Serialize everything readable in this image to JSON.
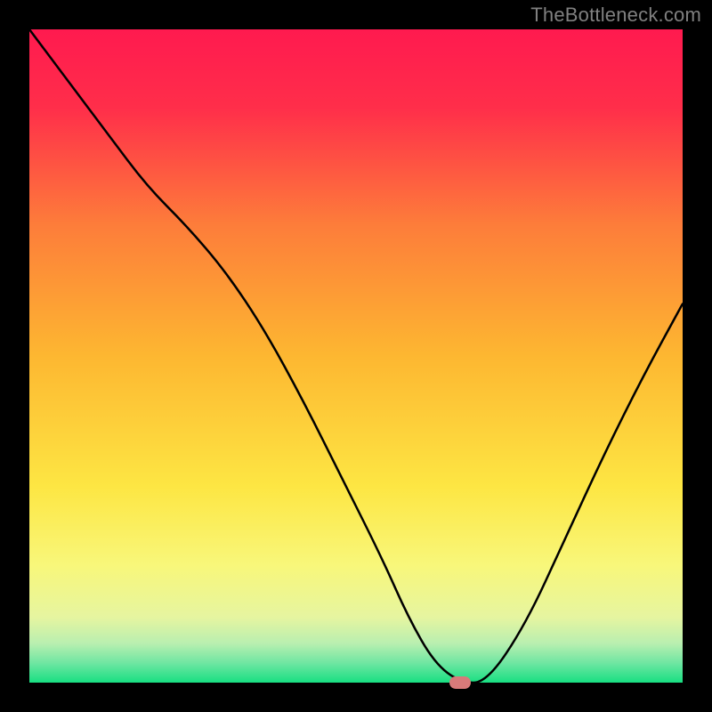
{
  "watermark": "TheBottleneck.com",
  "chart_data": {
    "type": "line",
    "title": "",
    "xlabel": "",
    "ylabel": "",
    "xlim": [
      0,
      100
    ],
    "ylim": [
      0,
      100
    ],
    "grid": false,
    "background": "red-yellow-green vertical gradient",
    "series": [
      {
        "name": "bottleneck-curve",
        "x": [
          0,
          6,
          12,
          18,
          24,
          30,
          36,
          42,
          48,
          54,
          58,
          62,
          66,
          70,
          76,
          82,
          88,
          94,
          100
        ],
        "y": [
          100,
          92,
          84,
          76,
          70,
          63,
          54,
          43,
          31,
          19,
          10,
          3,
          0,
          0,
          9,
          22,
          35,
          47,
          58
        ]
      }
    ],
    "marker": {
      "x": 66,
      "y": 0,
      "color": "#d87a7a"
    },
    "gradient_stops": [
      {
        "pos": 0.0,
        "color": "#ff1a4f"
      },
      {
        "pos": 0.12,
        "color": "#ff2e4a"
      },
      {
        "pos": 0.3,
        "color": "#fd7d3a"
      },
      {
        "pos": 0.5,
        "color": "#fdb731"
      },
      {
        "pos": 0.7,
        "color": "#fde643"
      },
      {
        "pos": 0.82,
        "color": "#f8f77a"
      },
      {
        "pos": 0.9,
        "color": "#e6f5a0"
      },
      {
        "pos": 0.94,
        "color": "#b9efb0"
      },
      {
        "pos": 0.97,
        "color": "#6fe6a2"
      },
      {
        "pos": 1.0,
        "color": "#18df82"
      }
    ]
  }
}
